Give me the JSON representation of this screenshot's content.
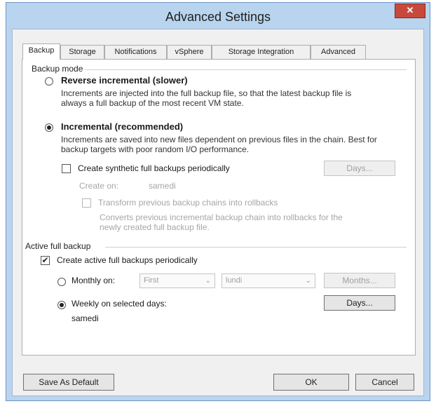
{
  "window": {
    "title": "Advanced Settings",
    "close_glyph": "✕"
  },
  "tabs": [
    "Backup",
    "Storage",
    "Notifications",
    "vSphere",
    "Storage Integration",
    "Advanced"
  ],
  "backup_mode": {
    "group_label": "Backup mode",
    "reverse": {
      "label": "Reverse incremental (slower)",
      "desc": "Increments are injected into the full backup file, so that the latest backup file is always a full backup of the most recent VM state.",
      "checked": false
    },
    "incremental": {
      "label": "Incremental (recommended)",
      "desc": "Increments are saved into new files dependent on previous files in the chain. Best for backup targets with poor random I/O performance.",
      "checked": true
    },
    "synthetic": {
      "label": "Create synthetic full backups periodically",
      "checked": false,
      "days_button": "Days...",
      "create_on_label": "Create on:",
      "create_on_value": "samedi",
      "transform_label": "Transform previous backup chains into rollbacks",
      "transform_desc": "Converts previous incremental backup chain into rollbacks for the newly created full backup file."
    }
  },
  "active_full": {
    "group_label": "Active full backup",
    "checkbox_label": "Create active full backups periodically",
    "checkbox_checked": true,
    "check_glyph": "✔",
    "monthly": {
      "label": "Monthly on:",
      "checked": false,
      "week_value": "First",
      "day_value": "lundi",
      "months_button": "Months..."
    },
    "weekly": {
      "label": "Weekly on selected days:",
      "checked": true,
      "days_button": "Days...",
      "days_value": "samedi"
    }
  },
  "footer": {
    "save_default": "Save As Default",
    "ok": "OK",
    "cancel": "Cancel"
  },
  "icons": {
    "dropdown": "chevron-down-icon",
    "arrow_glyph": "⌄"
  }
}
